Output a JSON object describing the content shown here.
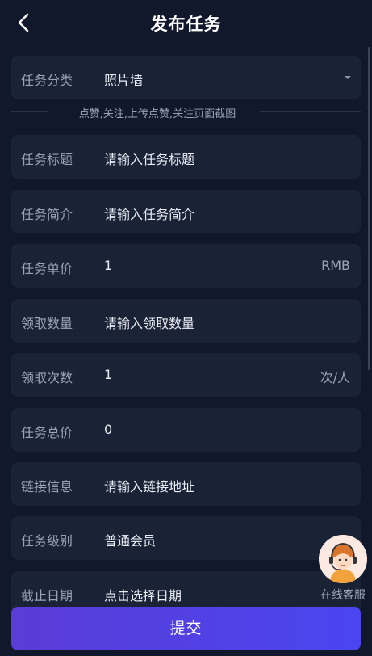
{
  "header": {
    "title": "发布任务",
    "back_icon": "chevron-left-icon"
  },
  "category": {
    "label": "任务分类",
    "value": "照片墙",
    "hint": "点赞,关注,上传点赞,关注页面截图"
  },
  "task_title": {
    "label": "任务标题",
    "placeholder": "请输入任务标题"
  },
  "task_intro": {
    "label": "任务简介",
    "placeholder": "请输入任务简介"
  },
  "unit_price": {
    "label": "任务单价",
    "value": "1",
    "suffix": "RMB"
  },
  "claim_quantity": {
    "label": "领取数量",
    "placeholder": "请输入领取数量"
  },
  "claim_times": {
    "label": "领取次数",
    "value": "1",
    "suffix": "次/人"
  },
  "total_price": {
    "label": "任务总价",
    "value": "0"
  },
  "link_info": {
    "label": "链接信息",
    "placeholder": "请输入链接地址"
  },
  "task_level": {
    "label": "任务级别",
    "value": "普通会员"
  },
  "deadline": {
    "label": "截止日期",
    "placeholder": "点击选择日期"
  },
  "online_service": {
    "label": "在线客服"
  },
  "submit": {
    "label": "提交"
  },
  "colors": {
    "background": "#11182b",
    "card": "#1a2236",
    "accent": "#4a45f0"
  }
}
